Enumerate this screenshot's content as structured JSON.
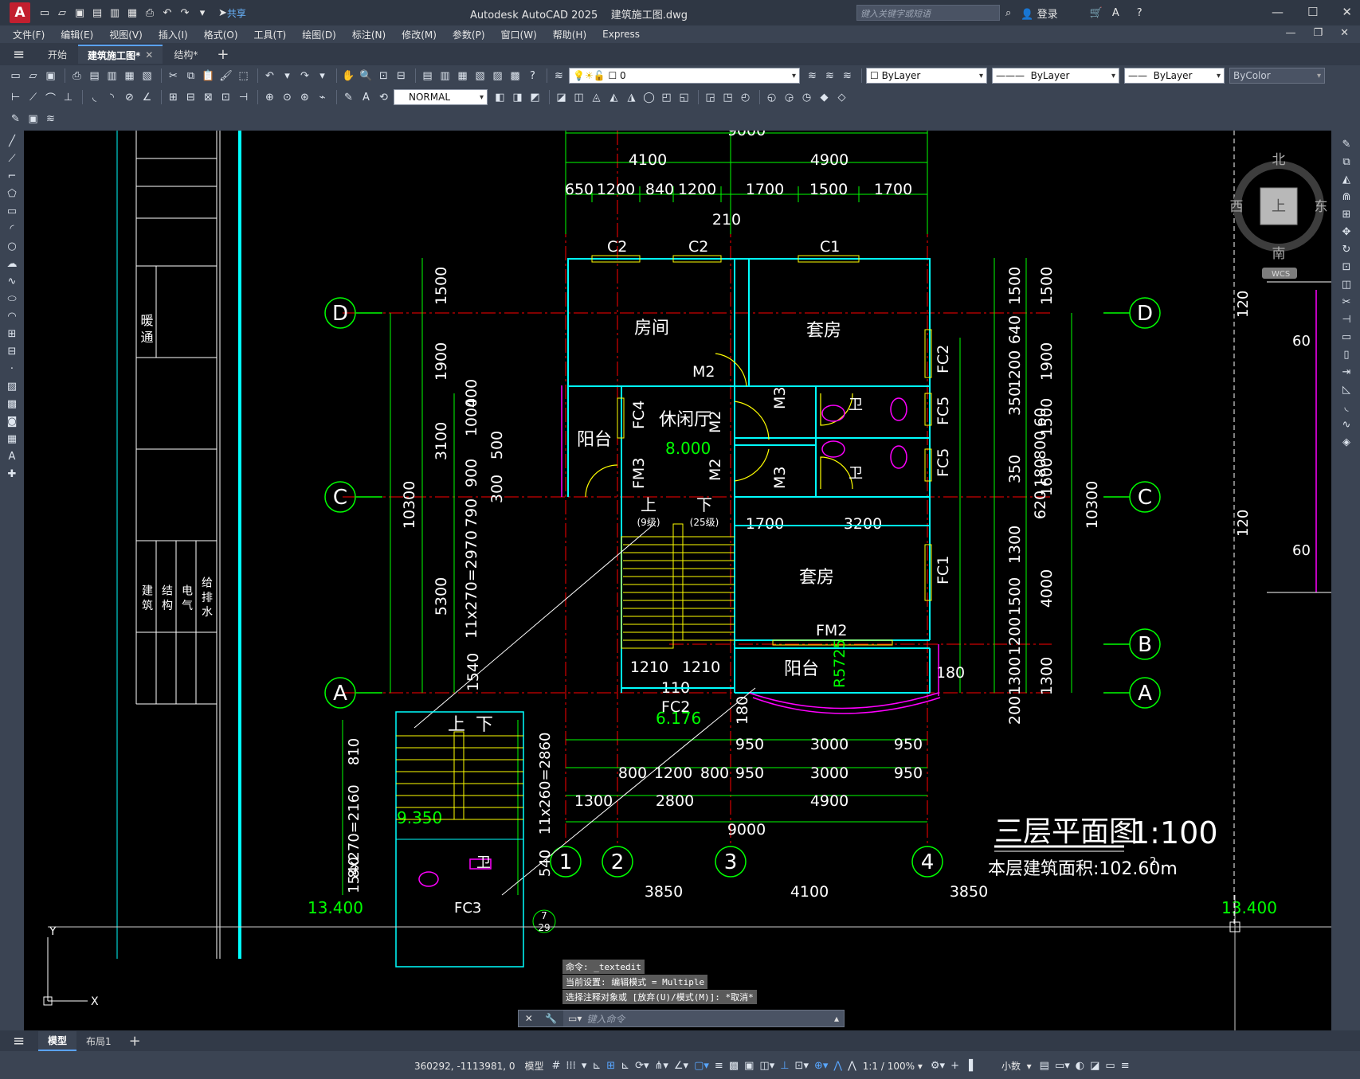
{
  "app": {
    "title": "Autodesk AutoCAD 2025",
    "document": "建筑施工图.dwg",
    "logo": "A",
    "share": "共享",
    "search_placeholder": "键入关键字或短语",
    "login": "登录"
  },
  "menu": [
    "文件(F)",
    "编辑(E)",
    "视图(V)",
    "插入(I)",
    "格式(O)",
    "工具(T)",
    "绘图(D)",
    "标注(N)",
    "修改(M)",
    "参数(P)",
    "窗口(W)",
    "帮助(H)",
    "Express"
  ],
  "tabs": [
    {
      "label": "开始"
    },
    {
      "label": "建筑施工图*"
    },
    {
      "label": "结构*"
    }
  ],
  "toolbar": {
    "layer_value": "0",
    "textstyle_value": "NORMAL",
    "color_value": "ByLayer",
    "linetype_value": "ByLayer",
    "lineweight_value": "ByLayer",
    "plotstyle_value": "ByColor"
  },
  "viewcube": {
    "north": "北",
    "south": "南",
    "east": "东",
    "west": "西",
    "face": "上",
    "wcs": "WCS"
  },
  "drawing": {
    "title": "三层平面图",
    "scale": "1:100",
    "area_label": "本层建筑面积:102.60m",
    "area_sup": "2",
    "axes_letters": [
      "D",
      "C",
      "B",
      "A"
    ],
    "axes_numbers": [
      "1",
      "2",
      "3",
      "4"
    ],
    "top_dims": {
      "total": "9000",
      "mid": [
        "4100",
        "4900"
      ],
      "detail": [
        "650",
        "1200",
        "840",
        "1200",
        "1700",
        "1500",
        "1700"
      ],
      "small": "210"
    },
    "bottom_dims": {
      "row1": [
        "950",
        "3000",
        "950"
      ],
      "row2": [
        "800",
        "1200",
        "800",
        "950",
        "3000",
        "950"
      ],
      "row3": [
        "1300",
        "2800",
        "4900"
      ],
      "total": "9000"
    },
    "left_dims": [
      "1500",
      "1900",
      "3100",
      "5300",
      "1540",
      "10300",
      "400",
      "1000",
      "500",
      "900",
      "300",
      "790",
      "11x270=2970"
    ],
    "right_dims": [
      "1500",
      "640",
      "1200",
      "350",
      "60",
      "800",
      "350",
      "180",
      "620",
      "1300",
      "1500",
      "1200",
      "1300",
      "200",
      "1500",
      "1900",
      "1500",
      "1600",
      "4000",
      "1300",
      "10300"
    ],
    "windows": [
      "C2",
      "C2",
      "C1",
      "FC2",
      "FC5",
      "FC5",
      "FC1",
      "FM2",
      "FC4",
      "FM3",
      "FC2"
    ],
    "rooms": [
      "房间",
      "套房",
      "休闲厅",
      "阳台",
      "卫",
      "卫",
      "套房",
      "阳台"
    ],
    "doors": [
      "M2",
      "M2",
      "M2",
      "M3",
      "M3"
    ],
    "elevations": [
      "8.000",
      "6.176",
      "9.350",
      "13.400",
      "13.400"
    ],
    "stair_labels": [
      "上",
      "下",
      "(9级)",
      "(25级)",
      "上",
      "下"
    ],
    "inner_dims": [
      "1700",
      "3200",
      "1210",
      "1210",
      "110",
      "180",
      "180",
      "R5725"
    ],
    "detail_dims": [
      "8x270=2160",
      "810",
      "1540",
      "11x260=2860",
      "540"
    ],
    "detail_labels": [
      "卫",
      "FC3"
    ],
    "bottom_axis_dims": [
      "3850",
      "4100",
      "3850"
    ],
    "right_detail": [
      "120",
      "60",
      "120",
      "60"
    ],
    "titleblock": {
      "upper": "暖 通",
      "lower": [
        "建 筑",
        "结 构",
        "电 气",
        "给 排 水"
      ]
    },
    "annotation_marker": [
      "7",
      "29"
    ]
  },
  "command": {
    "history": [
      "命令: _textedit",
      "当前设置: 编辑模式 = Multiple",
      "选择注释对象或 [放弃(U)/模式(M)]: *取消*"
    ],
    "placeholder": "键入命令"
  },
  "layout_tabs": [
    "模型",
    "布局1"
  ],
  "status": {
    "coords": "360292, -1113981, 0",
    "space": "模型",
    "scale": "1:1 / 100%",
    "units": "小数"
  },
  "colors": {
    "dim_green": "#00ff00",
    "wall_cyan": "#00ffff",
    "axis_red": "#ff0000",
    "window_yellow": "#ffff00",
    "magenta": "#ff00ff",
    "text_white": "#ffffff",
    "accent_blue": "#5aa2ff"
  }
}
